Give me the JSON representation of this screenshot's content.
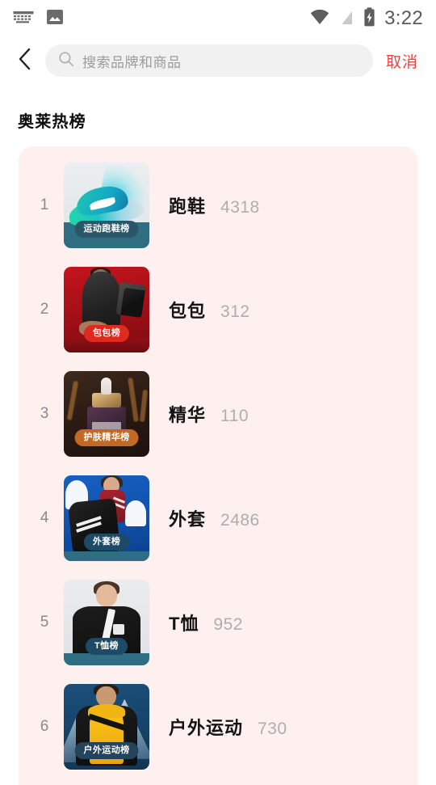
{
  "statusbar": {
    "time": "3:22",
    "icons_left": [
      "keyboard-icon",
      "image-icon"
    ],
    "icons_right": [
      "wifi-icon",
      "signal-off-icon",
      "battery-charging-icon"
    ]
  },
  "searchbar": {
    "back_icon": "chevron-left-icon",
    "search_icon": "search-icon",
    "placeholder": "搜索品牌和商品",
    "value": "",
    "cancel_label": "取消"
  },
  "section": {
    "title": "奥莱热榜"
  },
  "colors": {
    "accent_red": "#f0423c",
    "card_bg": "#fdf0ef",
    "title_text": "#141414",
    "count_text": "#aeaeae",
    "rank_text": "#8a8a8a",
    "page_bg": "#ffffff"
  },
  "ranking": [
    {
      "rank": "1",
      "title": "跑鞋",
      "count": "4318",
      "badge": "运动跑鞋榜",
      "badge_bg": "#2b5668",
      "art": "art-shoe"
    },
    {
      "rank": "2",
      "title": "包包",
      "count": "312",
      "badge": "包包榜",
      "badge_bg": "#e02a20",
      "art": "art-bag"
    },
    {
      "rank": "3",
      "title": "精华",
      "count": "110",
      "badge": "护肤精华榜",
      "badge_bg": "#c06a26",
      "art": "art-serum"
    },
    {
      "rank": "4",
      "title": "外套",
      "count": "2486",
      "badge": "外套榜",
      "badge_bg": "#1d4a66",
      "art": "art-coat"
    },
    {
      "rank": "5",
      "title": "T恤",
      "count": "952",
      "badge": "T恤榜",
      "badge_bg": "#1d4a66",
      "art": "art-tee"
    },
    {
      "rank": "6",
      "title": "户外运动",
      "count": "730",
      "badge": "户外运动榜",
      "badge_bg": "#24445c",
      "art": "art-out"
    }
  ]
}
